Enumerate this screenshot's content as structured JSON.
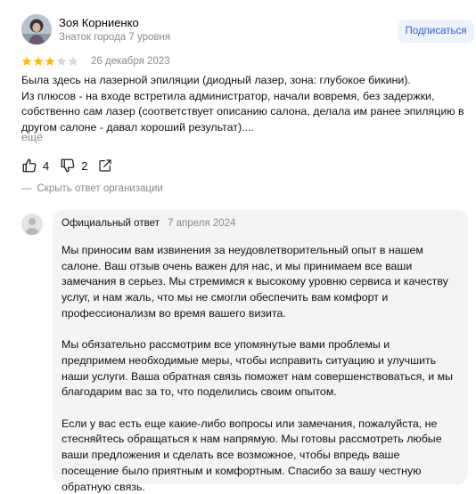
{
  "review": {
    "author_name": "Зоя Корниенко",
    "author_meta": "Знаток города 7 уровня",
    "subscribe_label": "Подписаться",
    "rating": 3,
    "rating_max": 5,
    "date": "26 декабря 2023",
    "text_lines": [
      "Была здесь на лазерной эпиляции (диодный лазер, зона: глубокое бикини).",
      "Из плюсов - на входе встретила администратор, начали вовремя, без задержки,",
      "собственно сам лазер (соответствует описанию салона, делала им ранее эпиляцию в",
      "другом салоне - давал хороший результат)...."
    ],
    "more_label": "ещё",
    "likes": "4",
    "dislikes": "2",
    "hide_answer_label": "Скрыть ответ организации"
  },
  "answer": {
    "label": "Официальный ответ",
    "date": "7 апреля 2024",
    "paragraphs": [
      [
        "Мы приносим вам извинения за неудовлетворительный опыт в нашем",
        "салоне. Ваш отзыв очень важен для нас, и мы принимаем все ваши",
        "замечания в серьез. Мы стремимся к высокому уровню сервиса и качеству",
        "услуг, и нам жаль, что мы не смогли обеспечить вам комфорт и",
        "профессионализм во время вашего визита."
      ],
      [
        "Мы обязательно рассмотрим все упомянутые вами проблемы и",
        "предпримем необходимые меры, чтобы исправить ситуацию и улучшить",
        "наши услуги. Ваша обратная связь поможет нам совершенствоваться, и мы",
        "благодарим вас за то, что поделились своим опытом."
      ],
      [
        "Если у вас есть еще какие-либо вопросы или замечания, пожалуйста, не",
        "стесняйтесь обращаться к нам напрямую. Мы готовы рассмотреть любые",
        "ваши предложения и сделать все возможное, чтобы впредь ваше",
        "посещение было приятным и комфортным. Спасибо за вашу честную",
        "обратную связь."
      ]
    ]
  },
  "colors": {
    "star_filled": "#fbbc05",
    "star_empty": "#d6d6d6",
    "accent": "#2f5cd4",
    "muted": "#8a8a8a"
  }
}
